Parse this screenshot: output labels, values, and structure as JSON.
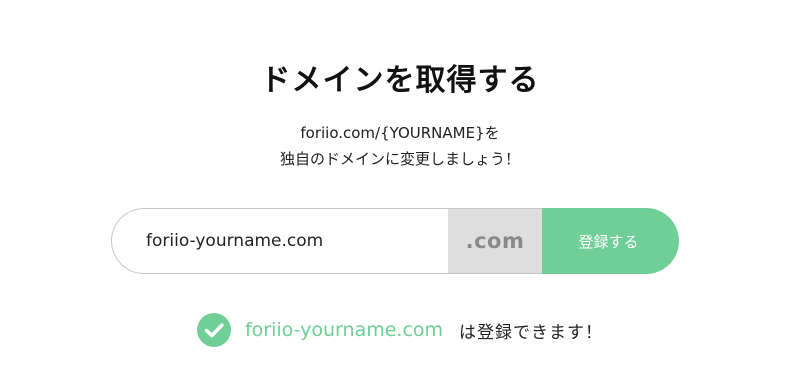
{
  "page": {
    "title": "ドメインを取得する",
    "subtitle_line1": "foriio.com/{YOURNAME}を",
    "subtitle_line2": "独自のドメインに変更しましょう！"
  },
  "form": {
    "input_value": "foriio-yourname.com",
    "suffix": ".com",
    "register_label": "登録する"
  },
  "status": {
    "icon": "check-circle-icon",
    "domain": "foriio-yourname.com",
    "message": "は登録できます！"
  },
  "colors": {
    "accent": "#6fcf97",
    "suffix_bg": "#dedede",
    "suffix_text": "#8a8a8a",
    "input_border": "#c8c8c8"
  }
}
